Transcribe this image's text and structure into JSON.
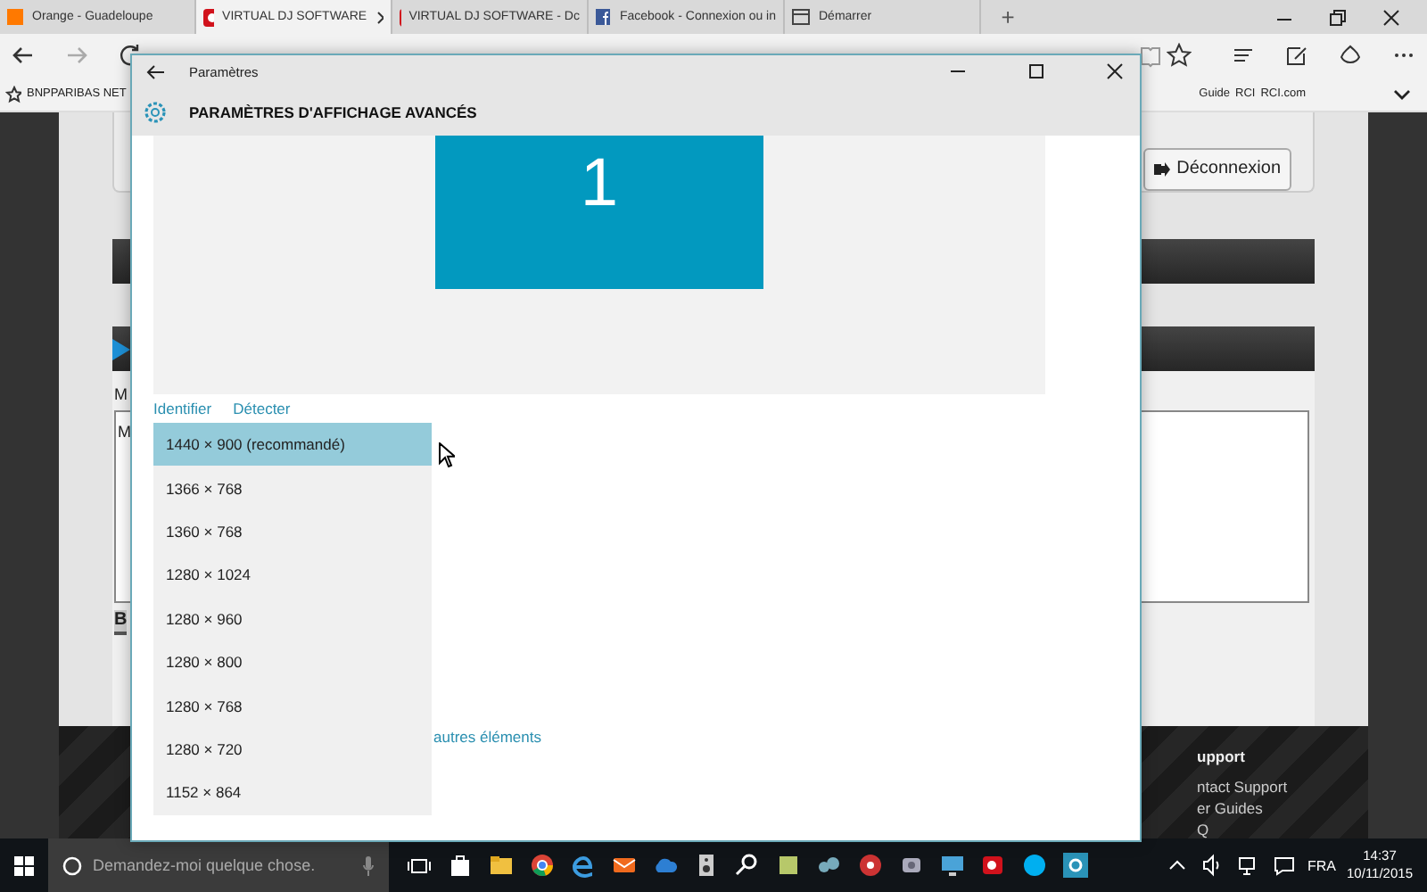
{
  "browser": {
    "tabs": [
      {
        "title": "Orange - Guadeloupe",
        "kind": "orange",
        "selected": false
      },
      {
        "title": "VIRTUAL DJ SOFTWARE",
        "kind": "vdj",
        "selected": true
      },
      {
        "title": "VIRTUAL DJ SOFTWARE - Dc",
        "kind": "vdj",
        "selected": false
      },
      {
        "title": "Facebook - Connexion ou in",
        "kind": "facebook",
        "selected": false
      },
      {
        "title": "Démarrer",
        "kind": "page",
        "selected": false
      }
    ],
    "new_tab": "+",
    "favorites_left": [
      "BNPPARIBAS NET"
    ],
    "favorites_right": [
      "Guide",
      "RCI",
      "RCI.com"
    ]
  },
  "page": {
    "logout_button": "Déconnexion",
    "label_fragment": "M",
    "field_fragment": "M",
    "button_fragment": "B",
    "footer": {
      "heading": "upport",
      "links": [
        "ntact Support",
        "er Guides",
        "Q"
      ]
    }
  },
  "settings": {
    "title": "Paramètres",
    "heading": "PARAMÈTRES D'AFFICHAGE AVANCÉS",
    "monitor_label": "1",
    "links": [
      "Identifier",
      "Détecter"
    ],
    "resolutions": [
      {
        "label": "1440 × 900 (recommandé)",
        "selected": true
      },
      {
        "label": "1366 × 768",
        "selected": false
      },
      {
        "label": "1360 × 768",
        "selected": false
      },
      {
        "label": "1280 × 1024",
        "selected": false
      },
      {
        "label": "1280 × 960",
        "selected": false
      },
      {
        "label": "1280 × 800",
        "selected": false
      },
      {
        "label": "1280 × 768",
        "selected": false
      },
      {
        "label": "1280 × 720",
        "selected": false
      },
      {
        "label": "1152 × 864",
        "selected": false
      }
    ],
    "more_link": "autres éléments"
  },
  "taskbar": {
    "search_placeholder": "Demandez-moi quelque chose.",
    "language": "FRA",
    "time": "14:37",
    "date": "10/11/2015"
  }
}
